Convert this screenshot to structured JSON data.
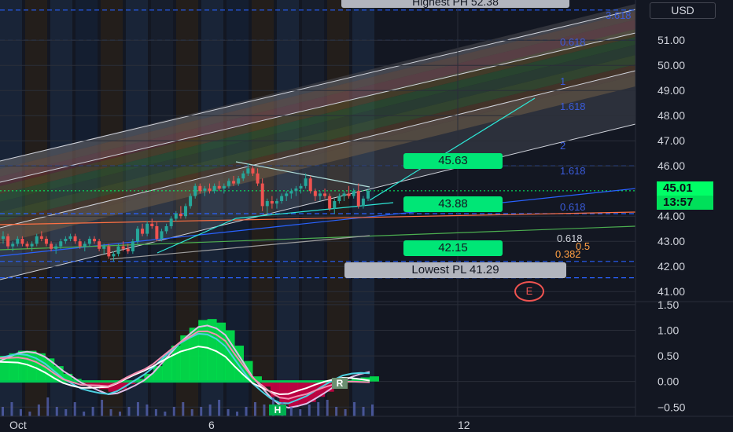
{
  "currency": "USD",
  "highest_label": "Highest PH 52.38",
  "lowest_label": "Lowest PL 41.29",
  "last_price": "45.01",
  "countdown": "13:57",
  "event_badge": "E",
  "colors": {
    "background": "#131722",
    "bull": "#26a69a",
    "bear": "#ef5350",
    "neon_green": "#00ff66",
    "channel_line": "#d1d4dc",
    "dash_blue": "#2962ff",
    "osc_green": "#00e64d",
    "osc_red": "#cc0044"
  },
  "fib_levels": [
    {
      "label": "0.618",
      "color": "#d1d4dc"
    },
    {
      "label": "0.5",
      "color": "#ff9f43"
    },
    {
      "label": "0.382",
      "color": "#ff9f43"
    }
  ],
  "upper_fib_labels": [
    "0.618",
    "1.618",
    "2",
    "1.618",
    "0.618",
    "0",
    "3.618",
    "1"
  ],
  "target_labels": [
    {
      "text": "45.63"
    },
    {
      "text": "43.88"
    },
    {
      "text": "42.15"
    }
  ],
  "pattern_labels": [
    "H",
    "R"
  ],
  "chart_data": [
    {
      "type": "candlestick",
      "title": "",
      "x_ticks": [
        "Oct",
        "6",
        "12"
      ],
      "y_ticks": [
        "51.00",
        "50.00",
        "49.00",
        "48.00",
        "47.00",
        "46.00",
        "44.00",
        "43.00",
        "42.00",
        "41.00"
      ],
      "ylim": [
        40.6,
        52.6
      ],
      "candles": [
        [
          43.1,
          43.4,
          42.9,
          43.2
        ],
        [
          43.2,
          43.3,
          42.7,
          42.8
        ],
        [
          42.8,
          43.0,
          42.6,
          42.9
        ],
        [
          42.9,
          43.2,
          42.8,
          43.1
        ],
        [
          43.1,
          43.2,
          42.8,
          42.9
        ],
        [
          42.9,
          43.0,
          42.7,
          42.8
        ],
        [
          42.8,
          43.0,
          42.6,
          42.9
        ],
        [
          42.9,
          43.3,
          42.8,
          43.2
        ],
        [
          43.2,
          43.4,
          43.0,
          43.1
        ],
        [
          43.1,
          43.2,
          42.8,
          42.9
        ],
        [
          42.9,
          43.0,
          42.6,
          42.7
        ],
        [
          42.7,
          42.9,
          42.5,
          42.8
        ],
        [
          42.8,
          43.1,
          42.7,
          43.0
        ],
        [
          43.0,
          43.2,
          42.9,
          43.1
        ],
        [
          43.1,
          43.3,
          43.0,
          43.2
        ],
        [
          43.2,
          43.3,
          42.9,
          43.0
        ],
        [
          43.0,
          43.1,
          42.7,
          42.8
        ],
        [
          42.8,
          43.0,
          42.6,
          42.9
        ],
        [
          42.9,
          43.2,
          42.8,
          43.1
        ],
        [
          43.1,
          43.2,
          42.9,
          43.0
        ],
        [
          43.0,
          43.1,
          42.6,
          42.7
        ],
        [
          42.7,
          42.9,
          42.5,
          42.8
        ],
        [
          42.8,
          42.9,
          42.3,
          42.4
        ],
        [
          42.4,
          42.6,
          42.2,
          42.5
        ],
        [
          42.5,
          42.9,
          42.4,
          42.8
        ],
        [
          42.8,
          43.0,
          42.6,
          42.7
        ],
        [
          42.7,
          42.9,
          42.5,
          42.6
        ],
        [
          42.6,
          43.1,
          42.5,
          43.0
        ],
        [
          43.0,
          43.6,
          42.9,
          43.5
        ],
        [
          43.5,
          43.7,
          43.2,
          43.3
        ],
        [
          43.3,
          43.8,
          43.2,
          43.7
        ],
        [
          43.7,
          43.9,
          43.5,
          43.6
        ],
        [
          43.6,
          43.8,
          43.0,
          43.1
        ],
        [
          43.1,
          43.5,
          43.0,
          43.4
        ],
        [
          43.4,
          43.7,
          43.3,
          43.6
        ],
        [
          43.6,
          44.0,
          43.5,
          43.9
        ],
        [
          43.9,
          44.2,
          43.8,
          44.1
        ],
        [
          44.1,
          44.4,
          43.9,
          44.0
        ],
        [
          44.0,
          44.5,
          43.9,
          44.4
        ],
        [
          44.4,
          44.9,
          44.3,
          44.8
        ],
        [
          44.8,
          45.3,
          44.7,
          45.2
        ],
        [
          45.2,
          45.3,
          44.9,
          45.0
        ],
        [
          45.0,
          45.2,
          44.8,
          45.1
        ],
        [
          45.1,
          45.3,
          44.9,
          45.0
        ],
        [
          45.0,
          45.3,
          44.9,
          45.2
        ],
        [
          45.2,
          45.4,
          45.0,
          45.1
        ],
        [
          45.1,
          45.3,
          44.9,
          45.2
        ],
        [
          45.2,
          45.5,
          45.1,
          45.4
        ],
        [
          45.4,
          45.6,
          45.2,
          45.3
        ],
        [
          45.3,
          45.6,
          45.2,
          45.5
        ],
        [
          45.5,
          45.8,
          45.4,
          45.7
        ],
        [
          45.7,
          46.1,
          45.6,
          45.9
        ],
        [
          45.9,
          46.0,
          45.6,
          45.7
        ],
        [
          45.7,
          45.9,
          45.2,
          45.3
        ],
        [
          45.3,
          45.5,
          44.2,
          44.4
        ],
        [
          44.4,
          44.7,
          44.1,
          44.6
        ],
        [
          44.6,
          44.8,
          44.3,
          44.5
        ],
        [
          44.5,
          44.7,
          44.3,
          44.6
        ],
        [
          44.6,
          44.9,
          44.5,
          44.8
        ],
        [
          44.8,
          45.0,
          44.6,
          44.9
        ],
        [
          44.9,
          45.1,
          44.7,
          45.0
        ],
        [
          45.0,
          45.2,
          44.8,
          45.1
        ],
        [
          45.1,
          45.3,
          44.9,
          45.2
        ],
        [
          45.2,
          45.7,
          45.1,
          45.5
        ],
        [
          45.5,
          45.6,
          44.9,
          45.0
        ],
        [
          45.0,
          45.1,
          44.6,
          44.8
        ],
        [
          44.8,
          45.0,
          44.6,
          44.9
        ],
        [
          44.9,
          45.1,
          44.7,
          44.8
        ],
        [
          44.8,
          44.9,
          44.2,
          44.3
        ],
        [
          44.3,
          44.7,
          44.1,
          44.6
        ],
        [
          44.6,
          44.9,
          44.5,
          44.8
        ],
        [
          44.8,
          45.0,
          44.6,
          44.9
        ],
        [
          44.9,
          45.2,
          44.7,
          44.8
        ],
        [
          44.8,
          45.1,
          44.7,
          45.0
        ],
        [
          45.0,
          45.3,
          44.3,
          44.4
        ],
        [
          44.4,
          44.8,
          44.3,
          44.7
        ],
        [
          44.7,
          45.1,
          44.6,
          45.01
        ]
      ]
    },
    {
      "type": "area",
      "title": "",
      "y_ticks": [
        "1.50",
        "1.00",
        "0.50",
        "0.00",
        "−0.50"
      ],
      "ylim": [
        -0.68,
        1.56
      ],
      "series": [
        {
          "values": [
            0.5,
            0.55,
            0.6,
            0.6,
            0.55,
            0.45,
            0.3,
            0.15,
            0.05,
            -0.05,
            -0.1,
            -0.15,
            -0.2,
            -0.15,
            -0.05,
            0.05,
            0.15,
            0.3,
            0.5,
            0.7,
            0.9,
            1.05,
            1.2,
            1.22,
            1.15,
            1.0,
            0.7,
            0.4,
            0.1,
            -0.1,
            -0.3,
            -0.45,
            -0.5,
            -0.45,
            -0.4,
            -0.3,
            -0.2,
            -0.1,
            0.0,
            0.05,
            0.08,
            0.1
          ]
        }
      ],
      "volume": [
        0.2,
        0.3,
        0.15,
        0.1,
        0.25,
        0.4,
        0.2,
        0.15,
        0.3,
        0.1,
        0.2,
        0.35,
        0.15,
        0.1,
        0.2,
        0.3,
        0.25,
        0.15,
        0.1,
        0.2,
        0.3,
        0.15,
        0.2,
        0.25,
        0.35,
        0.15,
        0.1,
        0.2,
        0.3,
        0.25,
        0.4,
        0.3,
        0.2,
        0.15,
        0.25,
        0.3,
        0.35,
        0.2,
        0.15,
        0.3,
        0.2,
        0.25
      ]
    }
  ]
}
